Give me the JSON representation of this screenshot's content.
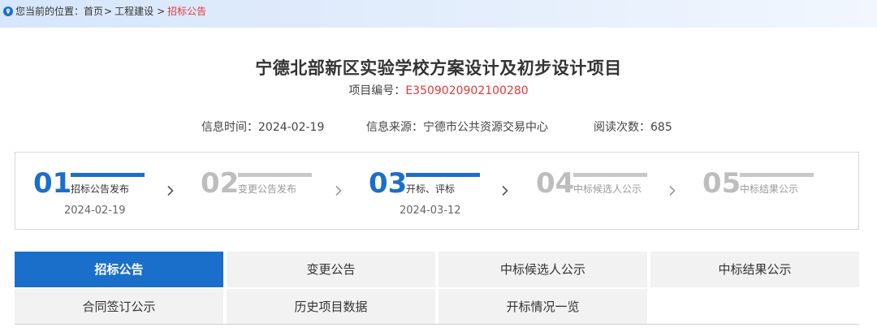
{
  "breadcrumb": {
    "prefix": "您当前的位置：",
    "home": "首页",
    "category": "工程建设",
    "current": "招标公告",
    "separator": ">"
  },
  "project": {
    "title": "宁德北部新区实验学校方案设计及初步设计项目",
    "number_label": "项目编号：",
    "number_value": "E3509020902100280"
  },
  "meta": {
    "time": "信息时间：2024-02-19",
    "source": "信息来源：宁德市公共资源交易中心",
    "views": "阅读次数：685"
  },
  "steps": [
    {
      "num": "01",
      "label": "招标公告发布",
      "date": "2024-02-19",
      "active": true
    },
    {
      "num": "02",
      "label": "变更公告发布",
      "date": "",
      "active": false
    },
    {
      "num": "03",
      "label": "开标、评标",
      "date": "2024-03-12",
      "active": true
    },
    {
      "num": "04",
      "label": "中标候选人公示",
      "date": "",
      "active": false
    },
    {
      "num": "05",
      "label": "中标结果公示",
      "date": "",
      "active": false
    }
  ],
  "tabs": [
    {
      "label": "招标公告",
      "active": true
    },
    {
      "label": "变更公告",
      "active": false
    },
    {
      "label": "中标候选人公示",
      "active": false
    },
    {
      "label": "中标结果公示",
      "active": false
    },
    {
      "label": "合同签订公示",
      "active": false
    },
    {
      "label": "历史项目数据",
      "active": false
    },
    {
      "label": "开标情况一览",
      "active": false
    }
  ],
  "colors": {
    "accent": "#1a6fca",
    "highlight": "#e03a3a",
    "inactive_step": "#bdbdbd"
  },
  "icons": {
    "breadcrumb": "location-pin-icon",
    "step_separator": "chevron-right-icon"
  }
}
